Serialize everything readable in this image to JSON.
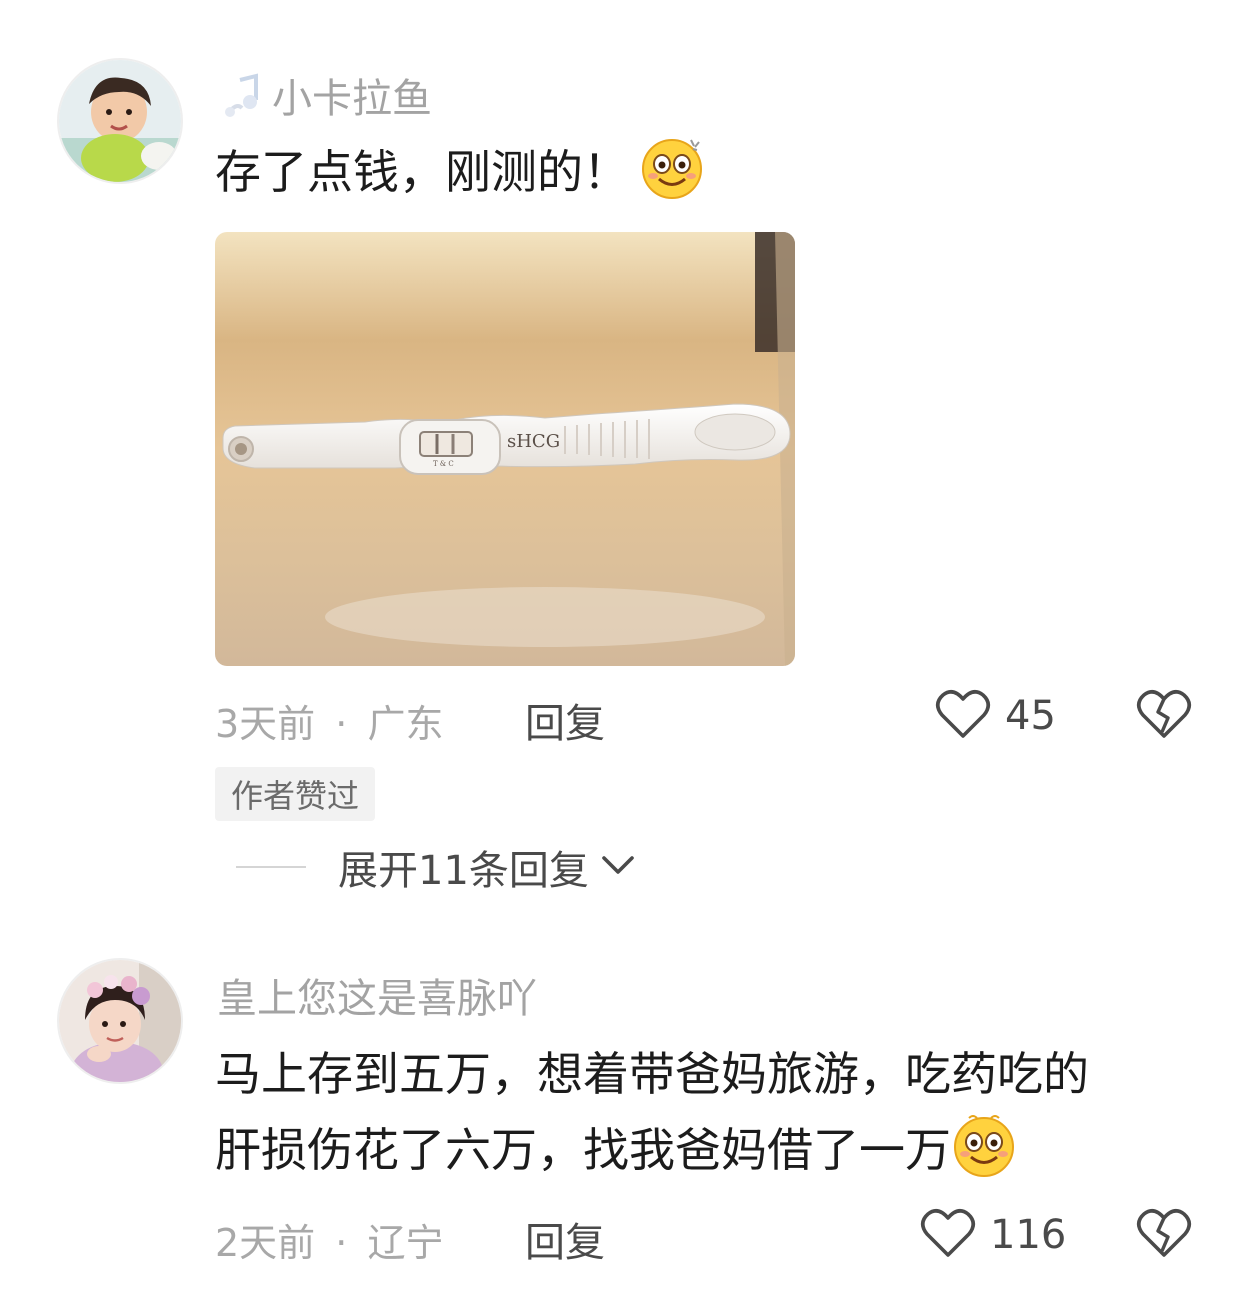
{
  "comments": [
    {
      "username": "小卡拉鱼",
      "text": "存了点钱，刚测的！",
      "emoji": "dizzy-smile-emoji",
      "image": {
        "strip_text": "sHCG",
        "window_marks": "T  &  C"
      },
      "time": "3天前",
      "location": "广东",
      "reply_label": "回复",
      "likes": "45",
      "author_badge": "作者赞过",
      "expand_label": "展开11条回复"
    },
    {
      "username": "皇上您这是喜脉吖",
      "text_line1": "马上存到五万，想着带爸妈旅游，吃药吃的",
      "text_line2": "肝损伤花了六万，找我爸妈借了一万",
      "emoji": "dizzy-smile-emoji",
      "time": "2天前",
      "location": "辽宁",
      "reply_label": "回复",
      "likes": "116"
    }
  ],
  "meta_separator": "·",
  "colors": {
    "meta_gray": "#a8a8a8",
    "text_dark": "#1c1c1c",
    "icon_gray": "#4a4a4a"
  }
}
